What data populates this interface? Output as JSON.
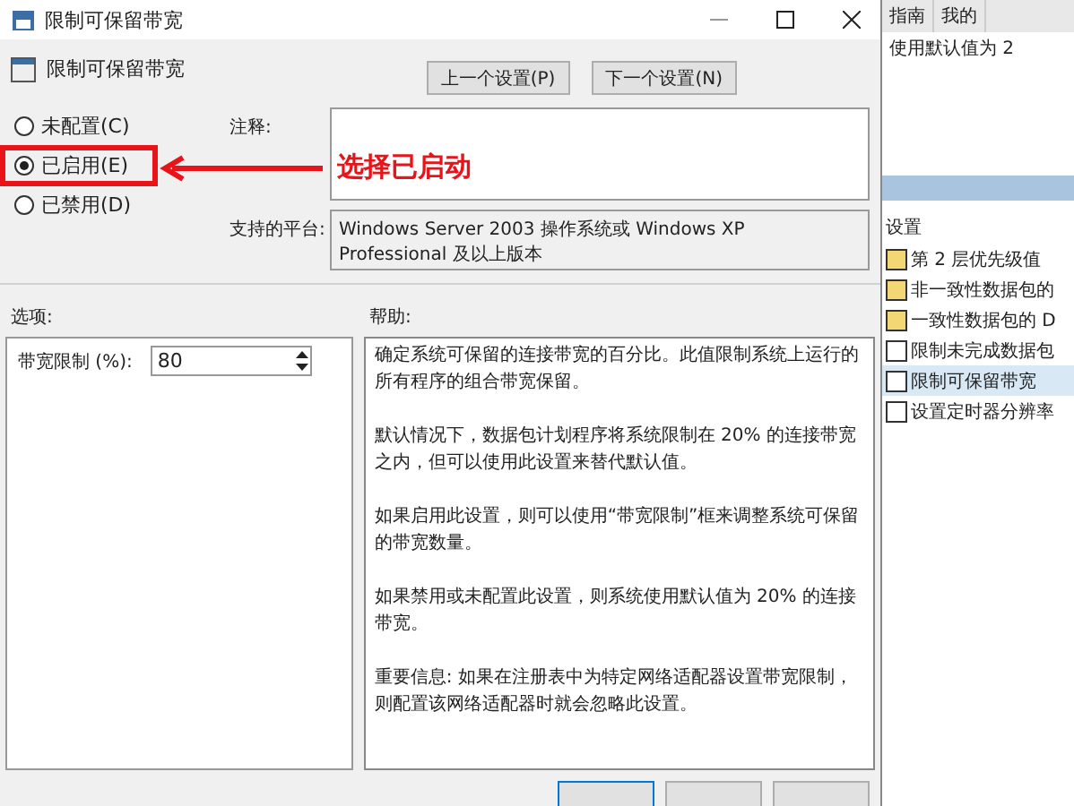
{
  "window": {
    "title": "限制可保留带宽"
  },
  "header": {
    "title": "限制可保留带宽",
    "buttons": [
      "上一个设置(P)",
      "下一个设置(N)"
    ]
  },
  "radios": [
    {
      "label": "未配置(C)",
      "selected": false,
      "highlighted": false
    },
    {
      "label": "已启用(E)",
      "selected": true,
      "highlighted": true
    },
    {
      "label": "已禁用(D)",
      "selected": false,
      "highlighted": false
    }
  ],
  "annotation": {
    "text": "选择已启动"
  },
  "comment": {
    "label": "注释:"
  },
  "platform": {
    "label": "支持的平台:",
    "value": "Windows Server 2003 操作系统或 Windows XP Professional 及以上版本"
  },
  "options": {
    "label": "选项:",
    "fields": [
      {
        "label": "带宽限制 (%):",
        "value": "80"
      }
    ]
  },
  "help": {
    "label": "帮助:",
    "paragraphs": [
      "确定系统可保留的连接带宽的百分比。此值限制系统上运行的所有程序的组合带宽保留。",
      "默认情况下，数据包计划程序将系统限制在 20% 的连接带宽之内，但可以使用此设置来替代默认值。",
      "如果启用此设置，则可以使用“带宽限制”框来调整系统可保留的带宽数量。",
      "如果禁用或未配置此设置，则系统使用默认值为 20% 的连接带宽。",
      "重要信息: 如果在注册表中为特定网络适配器设置带宽限制，则配置该网络适配器时就会忽略此设置。"
    ]
  },
  "background": {
    "tabs": [
      "指南",
      "我的"
    ],
    "text": "使用默认值为 2",
    "list_heading": "设置",
    "items": [
      {
        "label": "第 2 层优先级值",
        "kind": "folder",
        "selected": false
      },
      {
        "label": "非一致性数据包的",
        "kind": "folder",
        "selected": false
      },
      {
        "label": "一致性数据包的 D",
        "kind": "folder",
        "selected": false
      },
      {
        "label": "限制未完成数据包",
        "kind": "setting",
        "selected": false
      },
      {
        "label": "限制可保留带宽",
        "kind": "setting",
        "selected": true
      },
      {
        "label": "设置定时器分辨率",
        "kind": "setting",
        "selected": false
      }
    ]
  }
}
